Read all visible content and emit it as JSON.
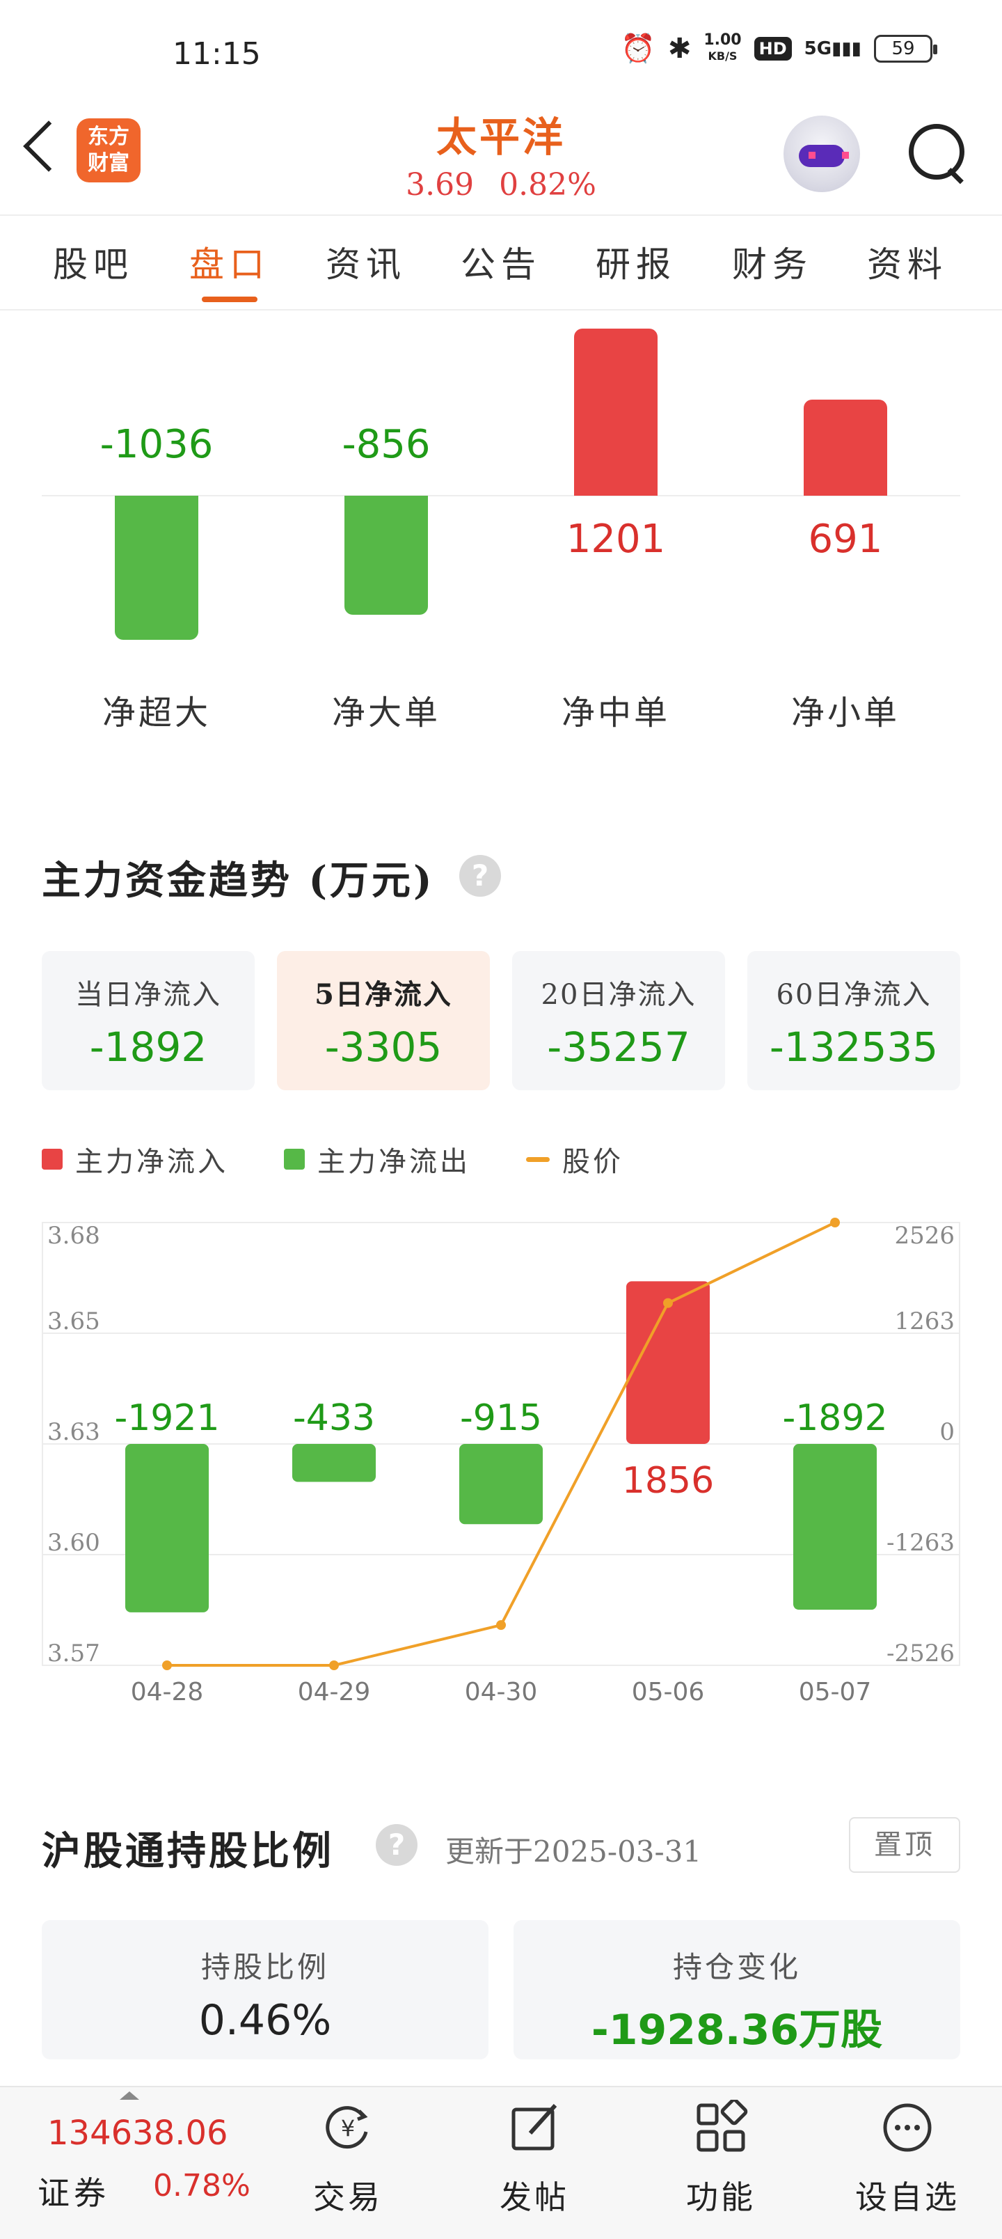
{
  "status_bar": {
    "time": "11:15",
    "net_speed_value": "1.00",
    "net_speed_unit": "KB/S",
    "hd": "HD",
    "signal": "5G",
    "battery": "59"
  },
  "header": {
    "logo_line1": "东方",
    "logo_line2": "财富",
    "stock_name": "太平洋",
    "price": "3.69",
    "change_pct": "0.82%"
  },
  "tabs": [
    {
      "label": "股吧",
      "active": false
    },
    {
      "label": "盘口",
      "active": true
    },
    {
      "label": "资讯",
      "active": false
    },
    {
      "label": "公告",
      "active": false
    },
    {
      "label": "研报",
      "active": false
    },
    {
      "label": "财务",
      "active": false
    },
    {
      "label": "资料",
      "active": false
    }
  ],
  "net_flow": {
    "items": [
      {
        "label": "净超大",
        "value": "-1036",
        "num": -1036
      },
      {
        "label": "净大单",
        "value": "-856",
        "num": -856
      },
      {
        "label": "净中单",
        "value": "1201",
        "num": 1201
      },
      {
        "label": "净小单",
        "value": "691",
        "num": 691
      }
    ]
  },
  "trend": {
    "title": "主力资金趋势 (万元)",
    "help": "?",
    "periods": [
      {
        "label": "当日净流入",
        "value": "-1892",
        "active": false
      },
      {
        "label": "5日净流入",
        "value": "-3305",
        "active": true
      },
      {
        "label": "20日净流入",
        "value": "-35257",
        "active": false
      },
      {
        "label": "60日净流入",
        "value": "-132535",
        "active": false
      }
    ],
    "legend": {
      "inflow": "主力净流入",
      "outflow": "主力净流出",
      "price": "股价"
    }
  },
  "chart_data": {
    "type": "bar",
    "categories": [
      "04-28",
      "04-29",
      "04-30",
      "05-06",
      "05-07"
    ],
    "series": [
      {
        "name": "主力净流入/主力净流出",
        "values": [
          -1921,
          -433,
          -915,
          1856,
          -1892
        ]
      },
      {
        "name": "股价",
        "type": "line",
        "values": [
          3.57,
          3.57,
          3.58,
          3.66,
          3.68
        ]
      }
    ],
    "left_axis_ticks": [
      "3.68",
      "3.65",
      "3.63",
      "3.60",
      "3.57"
    ],
    "right_axis_ticks": [
      "2526",
      "1263",
      "0",
      "-1263",
      "-2526"
    ],
    "ylim_flow": [
      -2526,
      2526
    ],
    "ylim_price": [
      3.57,
      3.68
    ],
    "colors": {
      "inflow": "#e84444",
      "outflow": "#56b847",
      "price": "#f0a028",
      "pos_label": "#d9302c",
      "neg_label": "#1f9a17"
    }
  },
  "hk_connect": {
    "title": "沪股通持股比例",
    "help": "?",
    "updated": "更新于2025-03-31",
    "pin_label": "置顶",
    "holding_ratio_label": "持股比例",
    "holding_ratio_value": "0.46%",
    "position_change_label": "持仓变化",
    "position_change_value": "-1928.36万股"
  },
  "bottom_bar": {
    "index_value": "134638.06",
    "index_name": "证券",
    "index_change": "0.78%",
    "items": [
      {
        "label": "交易",
        "icon": "yen-refresh-icon"
      },
      {
        "label": "发帖",
        "icon": "edit-icon"
      },
      {
        "label": "功能",
        "icon": "apps-grid-icon"
      },
      {
        "label": "设自选",
        "icon": "more-dots-icon"
      }
    ]
  }
}
